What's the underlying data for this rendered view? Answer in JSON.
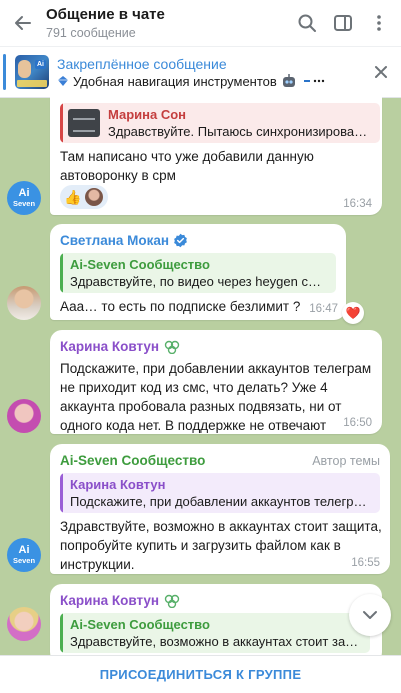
{
  "header": {
    "title": "Общение в чате",
    "subtitle": "791 сообщение"
  },
  "pinned": {
    "title": "Закреплённое сообщение",
    "preview": "Удобная навигация инструментов",
    "thumb_text": "Ai"
  },
  "messages": [
    {
      "quote_name": "Марина Сон",
      "quote_text": "Здравствуйте. Пытаюсь синхронизирова…",
      "text": "Там написано что уже добавили данную автоворонку в срм",
      "reaction": "👍",
      "time": "16:34"
    },
    {
      "sender": "Светлана Мокан",
      "quote_name": "Ai-Seven Сообщество",
      "quote_text": "Здравствуйте, по видео через heygen се…",
      "text": "Ааа…  то есть по подписке безлимит ?",
      "time": "16:47",
      "reaction": "❤️"
    },
    {
      "sender": "Карина Ковтун",
      "text": "Подскажите, при добавлении аккаунтов телеграм не приходит код из смс, что делать? Уже 4 аккаунта пробовала разных подвязать, ни от одного кода нет. В поддержке не отвечают",
      "time": "16:50"
    },
    {
      "sender": "Ai-Seven Сообщество",
      "role": "Автор темы",
      "quote_name": "Карина Ковтун",
      "quote_text": "Подскажите, при добавлении аккаунтов телегр…",
      "text": "Здравствуйте, возможно в аккаунтах стоит защита, попробуйте купить и загрузить файлом как в инструкции.",
      "time": "16:55"
    },
    {
      "sender": "Карина Ковтун",
      "quote_name": "Ai-Seven Сообщество",
      "quote_text": "Здравствуйте, возможно в аккаунтах стоит за…"
    }
  ],
  "avatar_ai": {
    "line1": "Ai",
    "line2": "Seven"
  },
  "footer": {
    "join_label": "ПРИСОЕДИНИТЬСЯ К ГРУППЕ"
  },
  "colors": {
    "accent": "#3b8ad9",
    "chat_bg": "#b9cfa0",
    "name_blue": "#3b8ad9",
    "name_purple": "#8a4fc9",
    "name_green": "#3e9c3e",
    "name_red": "#c43e3e"
  }
}
